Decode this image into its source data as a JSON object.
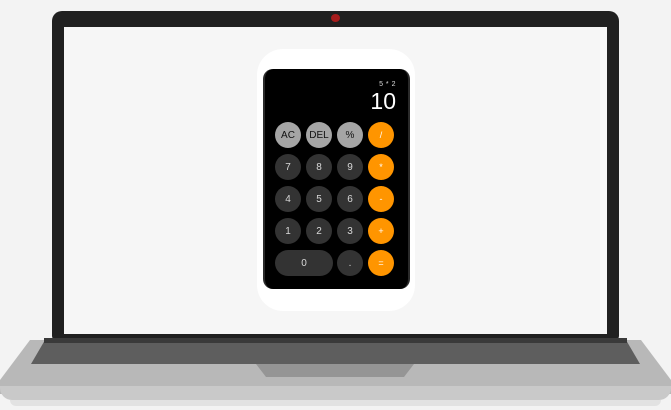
{
  "calculator": {
    "expression": "5 * 2",
    "result": "10",
    "keys": {
      "ac": "AC",
      "del": "DEL",
      "percent": "%",
      "divide": "/",
      "seven": "7",
      "eight": "8",
      "nine": "9",
      "multiply": "*",
      "four": "4",
      "five": "5",
      "six": "6",
      "subtract": "-",
      "one": "1",
      "two": "2",
      "three": "3",
      "add": "+",
      "zero": "0",
      "decimal": ".",
      "equals": "="
    }
  },
  "colors": {
    "operator": "#ff9500",
    "function": "#a5a5a5",
    "digit": "#333333",
    "display_bg": "#000000"
  }
}
